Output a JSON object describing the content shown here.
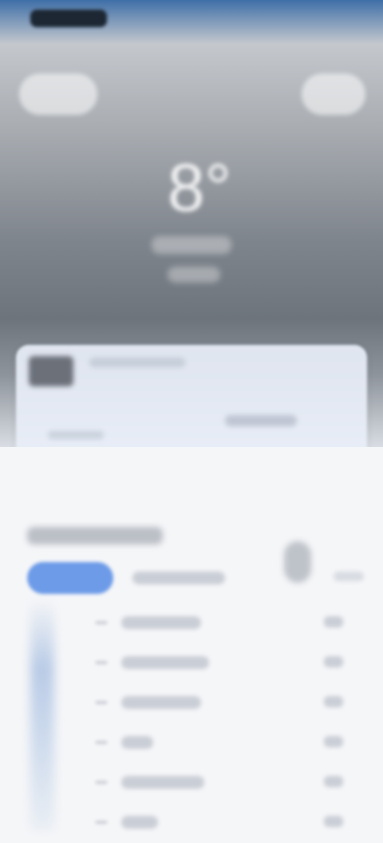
{
  "hero": {
    "temperature": "8°"
  },
  "colors": {
    "sky_top": "#3f6fa8",
    "accent_tab": "#6d9be8",
    "panel_bg": "#f5f6f8"
  }
}
